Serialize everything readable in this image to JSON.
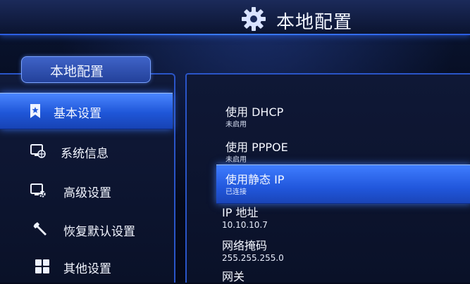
{
  "header": {
    "title": "本地配置",
    "icon": "gear-icon"
  },
  "left_panel": {
    "tab_label": "本地配置",
    "items": [
      {
        "label": "基本设置",
        "icon": "bookmark-star-icon",
        "selected": true
      },
      {
        "label": "系统信息",
        "icon": "monitor-globe-icon",
        "selected": false
      },
      {
        "label": "高级设置",
        "icon": "monitor-gear-icon",
        "selected": false
      },
      {
        "label": "恢复默认设置",
        "icon": "wrench-icon",
        "selected": false
      },
      {
        "label": "其他设置",
        "icon": "grid-icon",
        "selected": false
      }
    ]
  },
  "settings": [
    {
      "title": "使用 DHCP",
      "value": "未启用"
    },
    {
      "title": "使用 PPPOE",
      "value": "未启用"
    },
    {
      "title": "使用静态 IP",
      "value": "已连接",
      "selected": true
    },
    {
      "title": "IP 地址",
      "value": "10.10.10.7"
    },
    {
      "title": "网络掩码",
      "value": "255.255.255.0"
    },
    {
      "title": "网关",
      "value": ""
    }
  ],
  "colors": {
    "accent": "#2d5fe0",
    "selected_bg": "#2157dc",
    "background": "#050a1c"
  }
}
